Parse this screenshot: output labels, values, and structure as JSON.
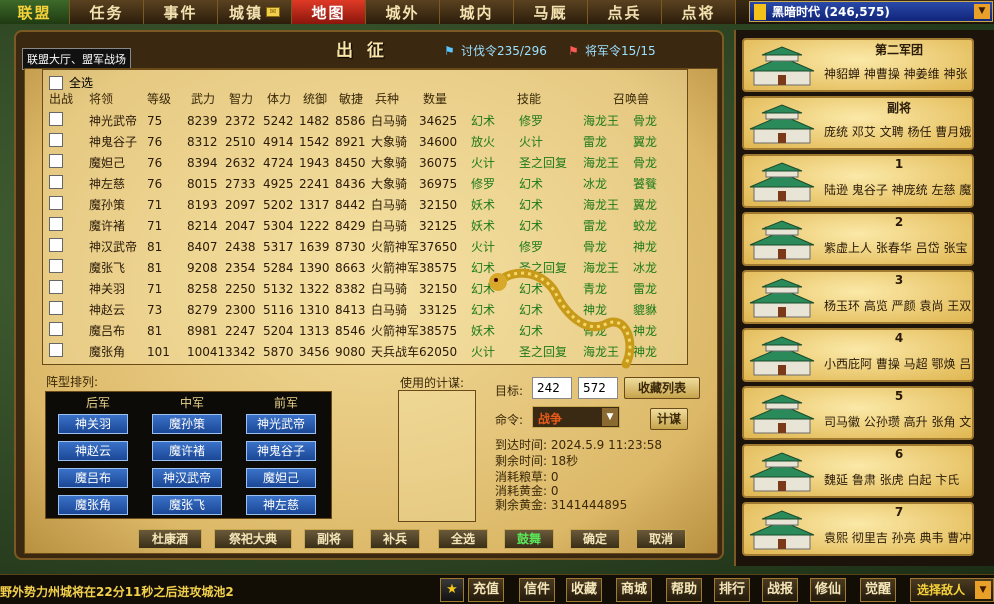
{
  "nav": [
    "联盟",
    "任务",
    "事件",
    "城镇",
    "地图",
    "城外",
    "城内",
    "马厩",
    "点兵",
    "点将"
  ],
  "server": {
    "label": "黑暗时代 (246,575)"
  },
  "panel": {
    "title": "出 征",
    "breadcrumb": "联盟大厅、盟军战场",
    "attack_order": "讨伐令235/296",
    "general_order": "将军令15/15"
  },
  "table": {
    "select_all": "全选",
    "headers": [
      "出战",
      "将领",
      "等级",
      "武力",
      "智力",
      "体力",
      "统御",
      "敏捷",
      "兵种",
      "数量",
      "技能",
      "召唤兽"
    ],
    "rows": [
      {
        "name": "神光武帝",
        "lv": "75",
        "wu": "8239",
        "zhi": "2372",
        "ti": "5242",
        "tong": "1482",
        "min": "8586",
        "bing": "白马骑",
        "num": "34625",
        "s1": "幻术",
        "s2": "修罗",
        "b1": "海龙王",
        "b2": "骨龙"
      },
      {
        "name": "神鬼谷子",
        "lv": "76",
        "wu": "8312",
        "zhi": "2510",
        "ti": "4914",
        "tong": "1542",
        "min": "8921",
        "bing": "大象骑",
        "num": "34600",
        "s1": "放火",
        "s2": "火计",
        "b1": "雷龙",
        "b2": "翼龙"
      },
      {
        "name": "魔妲己",
        "lv": "76",
        "wu": "8394",
        "zhi": "2632",
        "ti": "4724",
        "tong": "1943",
        "min": "8450",
        "bing": "大象骑",
        "num": "36075",
        "s1": "火计",
        "s2": "圣之回复",
        "b1": "海龙王",
        "b2": "骨龙"
      },
      {
        "name": "神左慈",
        "lv": "76",
        "wu": "8015",
        "zhi": "2733",
        "ti": "4925",
        "tong": "2241",
        "min": "8436",
        "bing": "大象骑",
        "num": "36975",
        "s1": "修罗",
        "s2": "幻术",
        "b1": "冰龙",
        "b2": "饕餮"
      },
      {
        "name": "魔孙策",
        "lv": "71",
        "wu": "8193",
        "zhi": "2097",
        "ti": "5202",
        "tong": "1317",
        "min": "8442",
        "bing": "白马骑",
        "num": "32150",
        "s1": "妖术",
        "s2": "幻术",
        "b1": "海龙王",
        "b2": "翼龙"
      },
      {
        "name": "魔许褚",
        "lv": "71",
        "wu": "8214",
        "zhi": "2047",
        "ti": "5304",
        "tong": "1222",
        "min": "8429",
        "bing": "白马骑",
        "num": "32125",
        "s1": "妖术",
        "s2": "幻术",
        "b1": "雷龙",
        "b2": "蛟龙"
      },
      {
        "name": "神汉武帝",
        "lv": "81",
        "wu": "8407",
        "zhi": "2438",
        "ti": "5317",
        "tong": "1639",
        "min": "8730",
        "bing": "火箭神军",
        "num": "37650",
        "s1": "火计",
        "s2": "修罗",
        "b1": "骨龙",
        "b2": "神龙"
      },
      {
        "name": "魔张飞",
        "lv": "81",
        "wu": "9208",
        "zhi": "2354",
        "ti": "5284",
        "tong": "1390",
        "min": "8663",
        "bing": "火箭神军",
        "num": "38575",
        "s1": "幻术",
        "s2": "圣之回复",
        "b1": "海龙王",
        "b2": "冰龙"
      },
      {
        "name": "神关羽",
        "lv": "71",
        "wu": "8258",
        "zhi": "2250",
        "ti": "5132",
        "tong": "1322",
        "min": "8382",
        "bing": "白马骑",
        "num": "32150",
        "s1": "幻术",
        "s2": "幻术",
        "b1": "青龙",
        "b2": "雷龙"
      },
      {
        "name": "神赵云",
        "lv": "73",
        "wu": "8279",
        "zhi": "2300",
        "ti": "5116",
        "tong": "1310",
        "min": "8413",
        "bing": "白马骑",
        "num": "33125",
        "s1": "幻术",
        "s2": "幻术",
        "b1": "神龙",
        "b2": "貔貅"
      },
      {
        "name": "魔吕布",
        "lv": "81",
        "wu": "8981",
        "zhi": "2247",
        "ti": "5204",
        "tong": "1313",
        "min": "8546",
        "bing": "火箭神军",
        "num": "38575",
        "s1": "妖术",
        "s2": "幻术",
        "b1": "骨龙",
        "b2": "神龙"
      },
      {
        "name": "魔张角",
        "lv": "101",
        "wu": "10041",
        "zhi": "3342",
        "ti": "5870",
        "tong": "3456",
        "min": "9080",
        "bing": "天兵战车",
        "num": "62050",
        "s1": "火计",
        "s2": "圣之回复",
        "b1": "海龙王",
        "b2": "神龙"
      }
    ]
  },
  "formation": {
    "label": "阵型排列:",
    "cols": [
      "后军",
      "中军",
      "前军"
    ],
    "grid": [
      [
        "神关羽",
        "魔孙策",
        "神光武帝"
      ],
      [
        "神赵云",
        "魔许褚",
        "神鬼谷子"
      ],
      [
        "魔吕布",
        "神汉武帝",
        "魔妲己"
      ],
      [
        "魔张角",
        "魔张飞",
        "神左慈"
      ]
    ]
  },
  "strategy": {
    "label": "使用的计谋:"
  },
  "target": {
    "label": "目标:",
    "x": "242",
    "y": "572",
    "fav": "收藏列表"
  },
  "command": {
    "label": "命令:",
    "value": "战争",
    "plan": "计谋"
  },
  "info": {
    "arrive": "到达时间:  2024.5.9  11:23:58",
    "remain": "剩余时间:  18秒",
    "food": "消耗粮草:  0",
    "gold": "消耗黄金:  0",
    "left_gold": "剩余黄金:  3141444895"
  },
  "buttons": [
    "杜康酒",
    "祭祀大典",
    "副将",
    "补兵",
    "全选",
    "鼓舞",
    "确定",
    "取消"
  ],
  "armies": [
    {
      "title": "第二军团",
      "members": "神貂蝉 神曹操 神姜维 神张"
    },
    {
      "title": "副将",
      "members": "庞统 邓艾 文聘 杨任 曹月娥"
    },
    {
      "title": "1",
      "members": "陆逊 鬼谷子 神庞统 左慈 魔"
    },
    {
      "title": "2",
      "members": "紫虚上人 张春华 吕岱 张宝"
    },
    {
      "title": "3",
      "members": "杨玉环 高览 严颜 袁尚 王双"
    },
    {
      "title": "4",
      "members": "小西庇阿 曹操 马超 鄂焕 吕"
    },
    {
      "title": "5",
      "members": "司马徽 公孙瓒 高升 张角 文"
    },
    {
      "title": "6",
      "members": "魏延 鲁肃 张虎 白起 卞氏"
    },
    {
      "title": "7",
      "members": "袁熙 彻里吉 孙亮 典韦 曹冲"
    }
  ],
  "status": {
    "ticker": "野外势力州城将在22分11秒之后进攻城池2",
    "buttons": [
      "充值",
      "信件",
      "收藏",
      "商城",
      "帮助",
      "排行",
      "战报",
      "修仙",
      "觉醒"
    ],
    "select_enemy": "选择敌人"
  },
  "colors": {
    "accent_green": "#1e7a1a",
    "button_blue": "#2a60b8",
    "title_gold": "#fbe6a8"
  }
}
